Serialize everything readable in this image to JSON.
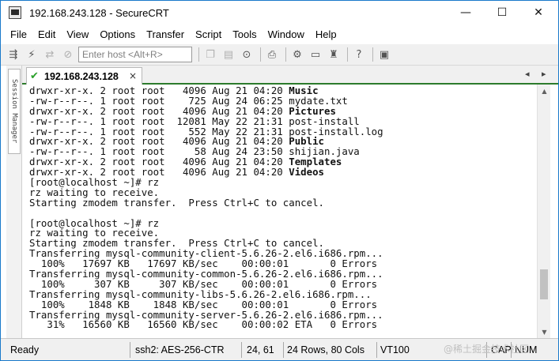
{
  "window": {
    "title": "192.168.243.128 - SecureCRT",
    "minimize_glyph": "—",
    "maximize_glyph": "☐",
    "close_glyph": "✕"
  },
  "menu": [
    "File",
    "Edit",
    "View",
    "Options",
    "Transfer",
    "Script",
    "Tools",
    "Window",
    "Help"
  ],
  "toolbar": {
    "host_placeholder": "Enter host <Alt+R>",
    "icons_left": [
      "connect-icon",
      "quick-connect-icon",
      "reconnect-icon",
      "disconnect-icon"
    ],
    "icons_right": [
      "copy-icon",
      "paste-icon",
      "find-icon",
      "print-icon",
      "settings-icon",
      "keymap-icon",
      "sftp-icon",
      "help-icon",
      "screen-icon"
    ]
  },
  "session_manager": {
    "label": "Session Manager"
  },
  "tab": {
    "label": "192.168.243.128",
    "close_glyph": "×",
    "prev_glyph": "◂",
    "next_glyph": "▸"
  },
  "terminal": {
    "lines": [
      {
        "text": "drwxr-xr-x. 2 root root   4096 Aug 21 04:20 ",
        "bold": "Music"
      },
      {
        "text": "-rw-r--r--. 1 root root    725 Aug 24 06:25 mydate.txt",
        "bold": ""
      },
      {
        "text": "drwxr-xr-x. 2 root root   4096 Aug 21 04:20 ",
        "bold": "Pictures"
      },
      {
        "text": "-rw-r--r--. 1 root root  12081 May 22 21:31 post-install",
        "bold": ""
      },
      {
        "text": "-rw-r--r--. 1 root root    552 May 22 21:31 post-install.log",
        "bold": ""
      },
      {
        "text": "drwxr-xr-x. 2 root root   4096 Aug 21 04:20 ",
        "bold": "Public"
      },
      {
        "text": "-rw-r--r--. 1 root root     58 Aug 24 23:50 shijian.java",
        "bold": ""
      },
      {
        "text": "drwxr-xr-x. 2 root root   4096 Aug 21 04:20 ",
        "bold": "Templates"
      },
      {
        "text": "drwxr-xr-x. 2 root root   4096 Aug 21 04:20 ",
        "bold": "Videos"
      },
      {
        "text": "[root@localhost ~]# rz",
        "bold": ""
      },
      {
        "text": "rz waiting to receive.",
        "bold": ""
      },
      {
        "text": "Starting zmodem transfer.  Press Ctrl+C to cancel.",
        "bold": ""
      },
      {
        "text": "",
        "bold": ""
      },
      {
        "text": "[root@localhost ~]# rz",
        "bold": ""
      },
      {
        "text": "rz waiting to receive.",
        "bold": ""
      },
      {
        "text": "Starting zmodem transfer.  Press Ctrl+C to cancel.",
        "bold": ""
      },
      {
        "text": "Transferring mysql-community-client-5.6.26-2.el6.i686.rpm...",
        "bold": ""
      },
      {
        "text": "  100%   17697 KB   17697 KB/sec    00:00:01       0 Errors",
        "bold": ""
      },
      {
        "text": "Transferring mysql-community-common-5.6.26-2.el6.i686.rpm...",
        "bold": ""
      },
      {
        "text": "  100%     307 KB     307 KB/sec    00:00:01       0 Errors",
        "bold": ""
      },
      {
        "text": "Transferring mysql-community-libs-5.6.26-2.el6.i686.rpm...",
        "bold": ""
      },
      {
        "text": "  100%    1848 KB    1848 KB/sec    00:00:01       0 Errors",
        "bold": ""
      },
      {
        "text": "Transferring mysql-community-server-5.6.26-2.el6.i686.rpm...",
        "bold": ""
      },
      {
        "text": "   31%   16560 KB   16560 KB/sec    00:00:02 ETA   0 Errors",
        "bold": ""
      }
    ]
  },
  "scrollbar": {
    "position_fraction": 0.87,
    "thumb_fraction": 0.13,
    "up_glyph": "▲",
    "down_glyph": "▼"
  },
  "status": {
    "ready": "Ready",
    "protocol": "ssh2: AES-256-CTR",
    "cursor": "24,  61",
    "size": "24 Rows, 80 Cols",
    "terminal_type": "VT100",
    "cap": "CAP",
    "num": "NUM"
  },
  "watermark": "@稀土掘金技术社区"
}
